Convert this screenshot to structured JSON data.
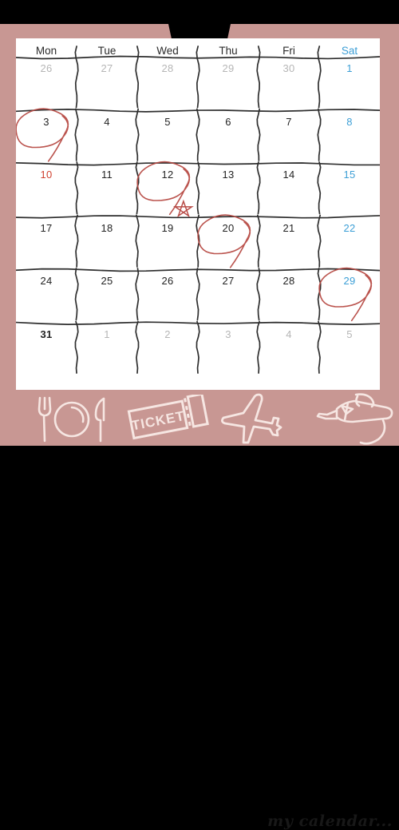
{
  "theme": {
    "frame_color": "#c89793",
    "sheet_color": "#ffffff",
    "bar_color": "#000000",
    "ink_color": "#b5453f",
    "saturday_color": "#3d9fd6",
    "holiday_color": "#d0402f",
    "muted_color": "#b6b6b6",
    "grid_color": "#2e2e2e"
  },
  "clip": {
    "name": "binder-clip"
  },
  "calendar": {
    "weekday_headers": [
      {
        "label": "Mon",
        "highlight": false
      },
      {
        "label": "Tue",
        "highlight": false
      },
      {
        "label": "Wed",
        "highlight": false
      },
      {
        "label": "Thu",
        "highlight": false
      },
      {
        "label": "Fri",
        "highlight": false
      },
      {
        "label": "Sat",
        "highlight": true
      }
    ],
    "weeks": [
      [
        {
          "day": "26",
          "state": "outside"
        },
        {
          "day": "27",
          "state": "outside"
        },
        {
          "day": "28",
          "state": "outside"
        },
        {
          "day": "29",
          "state": "outside"
        },
        {
          "day": "30",
          "state": "outside"
        },
        {
          "day": "1",
          "state": "saturday"
        }
      ],
      [
        {
          "day": "3",
          "state": "normal",
          "marked": "circle"
        },
        {
          "day": "4",
          "state": "normal"
        },
        {
          "day": "5",
          "state": "normal"
        },
        {
          "day": "6",
          "state": "normal"
        },
        {
          "day": "7",
          "state": "normal"
        },
        {
          "day": "8",
          "state": "saturday"
        }
      ],
      [
        {
          "day": "10",
          "state": "holiday"
        },
        {
          "day": "11",
          "state": "normal"
        },
        {
          "day": "12",
          "state": "normal",
          "marked": "circle-star"
        },
        {
          "day": "13",
          "state": "normal"
        },
        {
          "day": "14",
          "state": "normal"
        },
        {
          "day": "15",
          "state": "saturday"
        }
      ],
      [
        {
          "day": "17",
          "state": "normal"
        },
        {
          "day": "18",
          "state": "normal"
        },
        {
          "day": "19",
          "state": "normal"
        },
        {
          "day": "20",
          "state": "normal",
          "marked": "circle"
        },
        {
          "day": "21",
          "state": "normal"
        },
        {
          "day": "22",
          "state": "saturday"
        }
      ],
      [
        {
          "day": "24",
          "state": "normal"
        },
        {
          "day": "25",
          "state": "normal"
        },
        {
          "day": "26",
          "state": "normal"
        },
        {
          "day": "27",
          "state": "normal"
        },
        {
          "day": "28",
          "state": "normal"
        },
        {
          "day": "29",
          "state": "saturday",
          "marked": "circle"
        }
      ],
      [
        {
          "day": "31",
          "state": "normal"
        },
        {
          "day": "1",
          "state": "outside"
        },
        {
          "day": "2",
          "state": "outside"
        },
        {
          "day": "3",
          "state": "outside"
        },
        {
          "day": "4",
          "state": "outside"
        },
        {
          "day": "5",
          "state": "outside"
        }
      ]
    ]
  },
  "footer": {
    "icons": [
      {
        "name": "dining-icon",
        "label": "fork plate knife"
      },
      {
        "name": "ticket-icon",
        "label": "TICKET"
      },
      {
        "name": "airplane-icon",
        "label": "airplane"
      },
      {
        "name": "champagne-icon",
        "label": "hand pouring bottle"
      }
    ],
    "ticket_text": "TICKET",
    "signature": "my calendar..."
  }
}
